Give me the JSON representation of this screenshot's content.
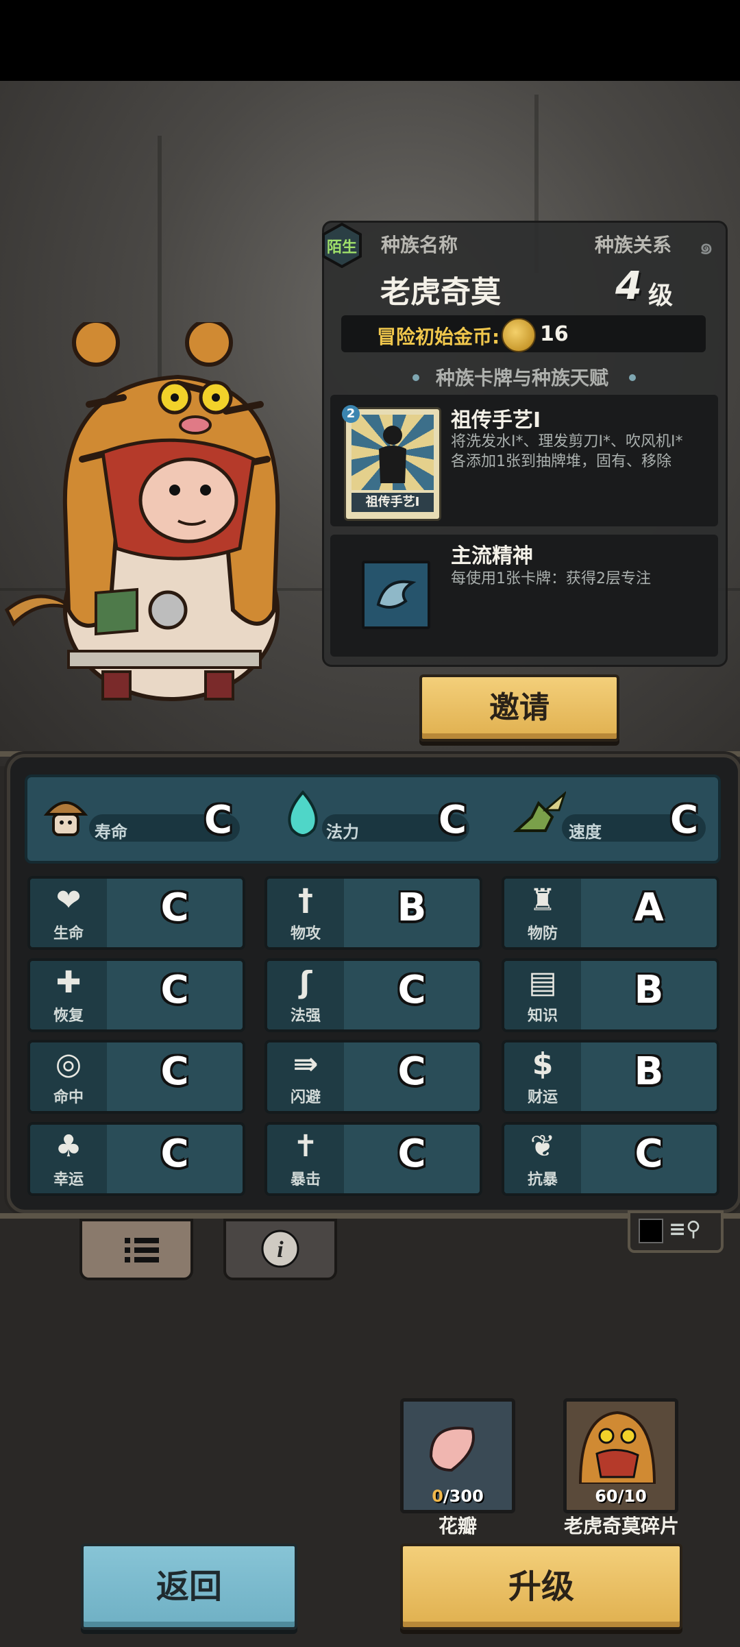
{
  "info": {
    "relation_badge": "陌生",
    "race_name_label": "种族名称",
    "race_relation_label": "种族关系",
    "hero_name": "老虎奇莫",
    "level_number": "4",
    "level_unit": "级",
    "start_gold_label": "冒险初始金币:",
    "start_gold_value": "16",
    "cards_header": "种族卡牌与种族天赋"
  },
  "skills": [
    {
      "title": "祖传手艺I",
      "desc_line1": "将洗发水I*、理发剪刀I*、吹风机I*",
      "desc_line2": "各添加1张到抽牌堆，固有、移除",
      "card_label": "祖传手艺I",
      "card_number": "2"
    },
    {
      "title": "主流精神",
      "desc_line1": "每使用1张卡牌：获得2层专注"
    }
  ],
  "invite_button": "邀请",
  "main_stats": [
    {
      "label": "寿命",
      "grade": "C",
      "icon": "mushroom-helmet-icon"
    },
    {
      "label": "法力",
      "grade": "C",
      "icon": "blue-flame-icon"
    },
    {
      "label": "速度",
      "grade": "C",
      "icon": "winged-boot-icon"
    }
  ],
  "stats": [
    {
      "label": "生命",
      "grade": "C",
      "icon": "heart-icon"
    },
    {
      "label": "物攻",
      "grade": "B",
      "icon": "sword-icon"
    },
    {
      "label": "物防",
      "grade": "A",
      "icon": "armor-icon"
    },
    {
      "label": "恢复",
      "grade": "C",
      "icon": "heart-plus-icon"
    },
    {
      "label": "法强",
      "grade": "C",
      "icon": "staff-icon"
    },
    {
      "label": "知识",
      "grade": "B",
      "icon": "book-icon"
    },
    {
      "label": "命中",
      "grade": "C",
      "icon": "target-icon"
    },
    {
      "label": "闪避",
      "grade": "C",
      "icon": "dodge-arrow-icon"
    },
    {
      "label": "财运",
      "grade": "B",
      "icon": "coin-dollar-icon"
    },
    {
      "label": "幸运",
      "grade": "C",
      "icon": "clover-icon"
    },
    {
      "label": "暴击",
      "grade": "C",
      "icon": "crit-icon"
    },
    {
      "label": "抗暴",
      "grade": "C",
      "icon": "shield-flower-icon"
    }
  ],
  "materials": [
    {
      "name": "花瓣",
      "count_have": "0",
      "count_need": "/300"
    },
    {
      "name": "老虎奇莫碎片",
      "count": "60/10"
    }
  ],
  "back_button": "返回",
  "upgrade_button": "升级",
  "colors": {
    "gold_button": "#e0b04f",
    "blue_button": "#6fb0c4",
    "stat_cell": "#2a4d58",
    "coin_text": "#f0c74c"
  }
}
